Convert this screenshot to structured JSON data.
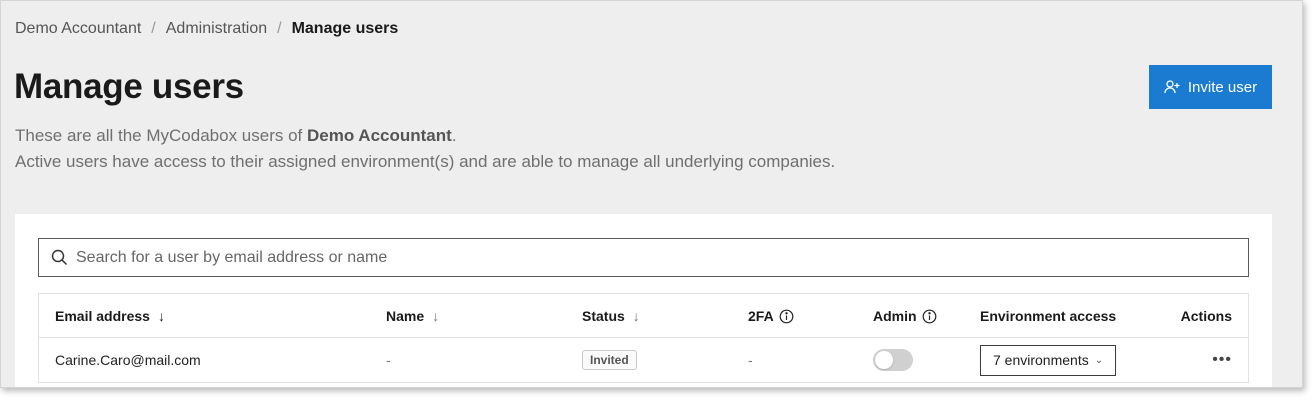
{
  "breadcrumb": {
    "items": [
      "Demo Accountant",
      "Administration"
    ],
    "separator": "/",
    "current": "Manage users"
  },
  "page": {
    "title": "Manage users",
    "description_prefix": "These are all the MyCodabox users of ",
    "description_org": "Demo Accountant",
    "description_suffix": ".",
    "description_line2": "Active users have access to their assigned environment(s) and are able to manage all underlying companies."
  },
  "invite_button": {
    "label": "Invite user",
    "icon": "add-user-icon",
    "color": "#1a7bd0"
  },
  "search": {
    "placeholder": "Search for a user by email address or name",
    "value": ""
  },
  "table": {
    "columns": {
      "email": "Email address",
      "name": "Name",
      "status": "Status",
      "twofa": "2FA",
      "admin": "Admin",
      "environment_access": "Environment access",
      "actions": "Actions"
    },
    "rows": [
      {
        "email": "Carine.Caro@mail.com",
        "name": "-",
        "status": "Invited",
        "twofa": "-",
        "admin": false,
        "environment_access": "7 environments",
        "actions": "•••"
      }
    ]
  }
}
